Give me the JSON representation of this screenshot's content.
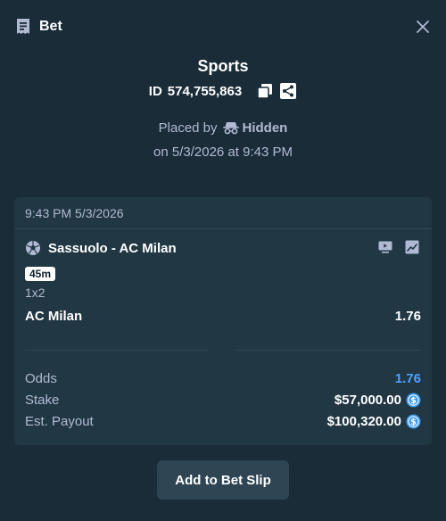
{
  "header": {
    "title": "Bet",
    "icon": "bet-slip-icon",
    "close_icon": "close-icon"
  },
  "summary": {
    "sport": "Sports",
    "id_label": "ID",
    "id_value": "574,755,863",
    "copy_icon": "copy-icon",
    "share_icon": "share-icon",
    "placed_by_label": "Placed by",
    "placed_by_user": "Hidden",
    "date_text": "on 5/3/2026 at 9:43 PM"
  },
  "card": {
    "timestamp": "9:43 PM 5/3/2026",
    "match": "Sassuolo - AC Milan",
    "live_badge": "45m",
    "market": "1x2",
    "outcome": "AC Milan",
    "outcome_odds": "1.76",
    "odds_label": "Odds",
    "odds_value": "1.76",
    "stake_label": "Stake",
    "stake_value": "$57,000.00",
    "payout_label": "Est. Payout",
    "payout_value": "$100,320.00"
  },
  "actions": {
    "add_to_slip": "Add to Bet Slip"
  },
  "colors": {
    "background": "#1a2c38",
    "card": "#213743",
    "accent_blue": "#4da1ff",
    "coin": "#3b9cf0",
    "muted": "#b1bad3"
  }
}
